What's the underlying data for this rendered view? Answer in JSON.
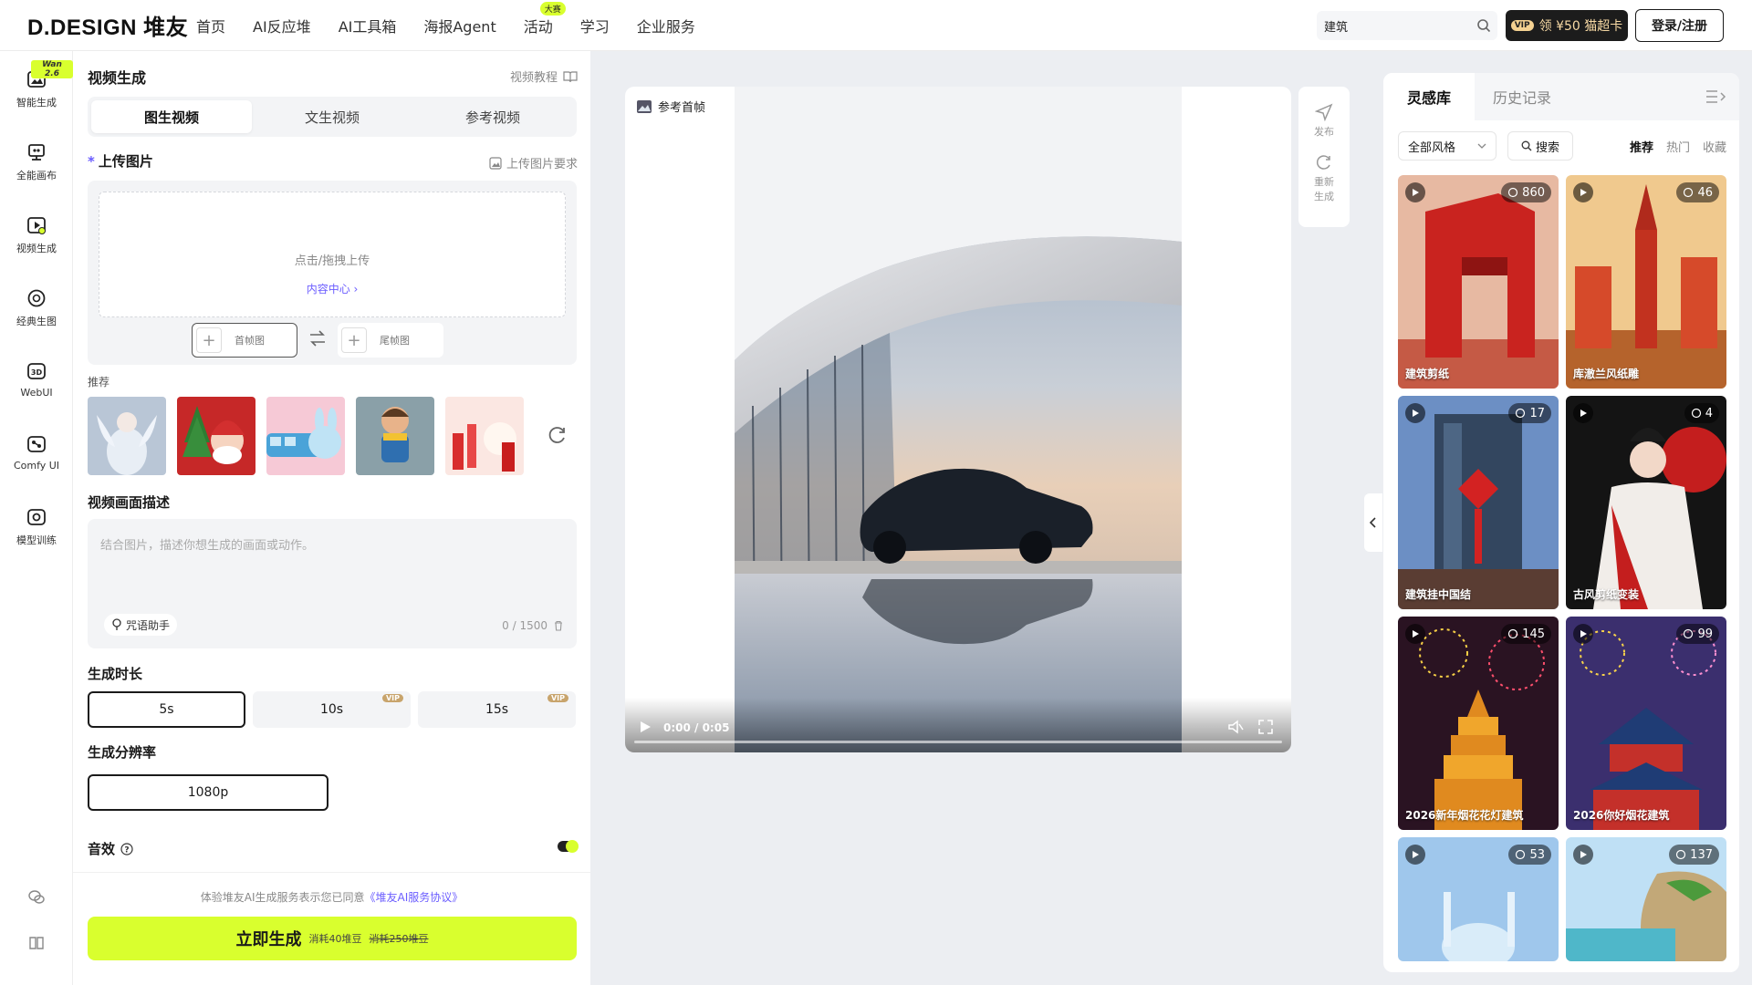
{
  "nav": {
    "brand": "D.DESIGN 堆友",
    "items": [
      {
        "label": "首页",
        "badge": ""
      },
      {
        "label": "AI反应堆",
        "badge": ""
      },
      {
        "label": "AI工具箱",
        "badge": ""
      },
      {
        "label": "海报Agent",
        "badge": ""
      },
      {
        "label": "活动",
        "badge": "大赛"
      },
      {
        "label": "学习",
        "badge": ""
      },
      {
        "label": "企业服务",
        "badge": ""
      }
    ],
    "search_value": "建筑",
    "vip_chip": "VIP",
    "vip_label": "领 ¥50 猫超卡",
    "login_label": "登录/注册"
  },
  "rail": {
    "wan_badge": "Wan 2.6",
    "items": [
      {
        "label": "智能生成",
        "icon": "image-sparkle-icon"
      },
      {
        "label": "全能画布",
        "icon": "canvas-icon"
      },
      {
        "label": "视频生成",
        "icon": "video-icon"
      },
      {
        "label": "经典生图",
        "icon": "palette-icon"
      },
      {
        "label": "WebUI",
        "icon": "3d-icon"
      },
      {
        "label": "Comfy UI",
        "icon": "nodes-icon"
      },
      {
        "label": "模型训练",
        "icon": "model-icon"
      }
    ]
  },
  "panel": {
    "title": "视频生成",
    "tutorial": "视频教程",
    "tabs": [
      "图生视频",
      "文生视频",
      "参考视频"
    ],
    "upload_title": "上传图片",
    "upload_required": "*",
    "upload_req_link": "上传图片要求",
    "dropzone_text": "点击/拖拽上传",
    "content_center": "内容中心 ›",
    "first_frame": "首帧图",
    "last_frame": "尾帧图",
    "recommend_label": "推荐",
    "desc_title": "视频画面描述",
    "desc_placeholder": "结合图片，描述你想生成的画面或动作。",
    "prompt_helper": "咒语助手",
    "counter": "0 / 1500",
    "duration_title": "生成时长",
    "durations": [
      {
        "label": "5s",
        "vip": ""
      },
      {
        "label": "10s",
        "vip": "VIP"
      },
      {
        "label": "15s",
        "vip": "VIP"
      }
    ],
    "resolution_title": "生成分辨率",
    "resolution": "1080p",
    "sound_title": "音效",
    "sound_on": true,
    "agreement_prefix": "体验堆友AI生成服务表示您已同意",
    "agreement_link": "《堆友AI服务协议》",
    "generate_label": "立即生成",
    "generate_cost": "消耗40堆豆",
    "generate_strike": "消耗250堆豆"
  },
  "stage": {
    "ref_label": "参考首帧",
    "time": "0:00 / 0:05",
    "progress": 0
  },
  "tools": {
    "publish": "发布",
    "regenerate_1": "重新",
    "regenerate_2": "生成"
  },
  "library": {
    "tab_active": "灵感库",
    "tab_history": "历史记录",
    "style_filter": "全部风格",
    "search_label": "搜索",
    "sorts": [
      "推荐",
      "热门",
      "收藏"
    ],
    "cards": [
      {
        "title": "建筑剪纸",
        "count": "860"
      },
      {
        "title": "库澈兰风纸雕",
        "count": "46"
      },
      {
        "title": "建筑挂中国结",
        "count": "17"
      },
      {
        "title": "古风剪纸变装",
        "count": "4"
      },
      {
        "title": "2026新年烟花花灯建筑",
        "count": "145"
      },
      {
        "title": "2026你好烟花建筑",
        "count": "99"
      },
      {
        "title": "",
        "count": "53"
      },
      {
        "title": "",
        "count": "137"
      }
    ]
  },
  "colors": {
    "accent": "#d9ff2e",
    "link": "#6a5cff",
    "vip_gold": "#f4d191"
  }
}
